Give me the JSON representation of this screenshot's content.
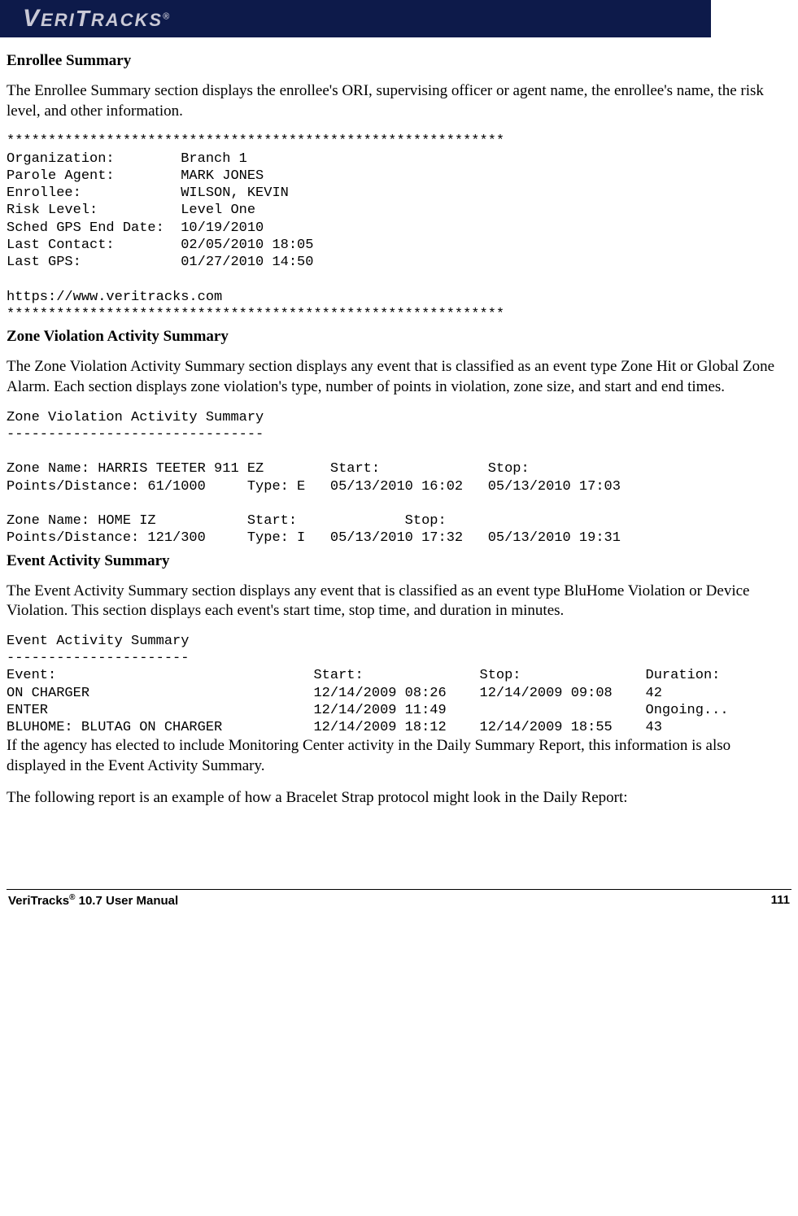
{
  "header": {
    "brand_prefix": "V",
    "brand_mid1": "ERI",
    "brand_t": "T",
    "brand_mid2": "RACKS",
    "brand_reg": "®"
  },
  "sections": {
    "enrollee": {
      "heading": "Enrollee Summary",
      "para": "The Enrollee Summary section displays the enrollee's ORI, supervising officer or agent name, the enrollee's name, the risk level, and other information.",
      "block": "************************************************************\nOrganization:        Branch 1\nParole Agent:        MARK JONES\nEnrollee:            WILSON, KEVIN\nRisk Level:          Level One\nSched GPS End Date:  10/19/2010\nLast Contact:        02/05/2010 18:05\nLast GPS:            01/27/2010 14:50\n\nhttps://www.veritracks.com\n************************************************************"
    },
    "zone": {
      "heading": "Zone Violation Activity Summary",
      "para": "The Zone Violation Activity Summary section displays any event that is classified as an event type Zone Hit or Global Zone Alarm.  Each section displays zone violation's type, number of points in violation, zone size, and start and end times.",
      "block": "Zone Violation Activity Summary\n-------------------------------\n\nZone Name: HARRIS TEETER 911 EZ        Start:             Stop:\nPoints/Distance: 61/1000     Type: E   05/13/2010 16:02   05/13/2010 17:03\n\nZone Name: HOME IZ           Start:             Stop:\nPoints/Distance: 121/300     Type: I   05/13/2010 17:32   05/13/2010 19:31"
    },
    "event": {
      "heading": "Event Activity Summary",
      "para": "The Event Activity Summary section displays any event that is classified as an event type BluHome Violation or Device Violation.  This section displays each event's start time, stop time, and duration in minutes.",
      "block": "Event Activity Summary\n----------------------\nEvent:                               Start:              Stop:               Duration:\nON CHARGER                           12/14/2009 08:26    12/14/2009 09:08    42\nENTER                                12/14/2009 11:49                        Ongoing...\nBLUHOME: BLUTAG ON CHARGER           12/14/2009 18:12    12/14/2009 18:55    43",
      "para2": "If the agency has elected to include Monitoring Center activity in the Daily Summary Report, this information is also displayed in the Event Activity Summary.",
      "para3": "The following report is an example of how a Bracelet Strap protocol might look in the Daily Report:"
    }
  },
  "footer": {
    "left_a": "VeriTracks",
    "left_sup": "®",
    "left_b": " 10.7 User Manual",
    "page": "111"
  }
}
